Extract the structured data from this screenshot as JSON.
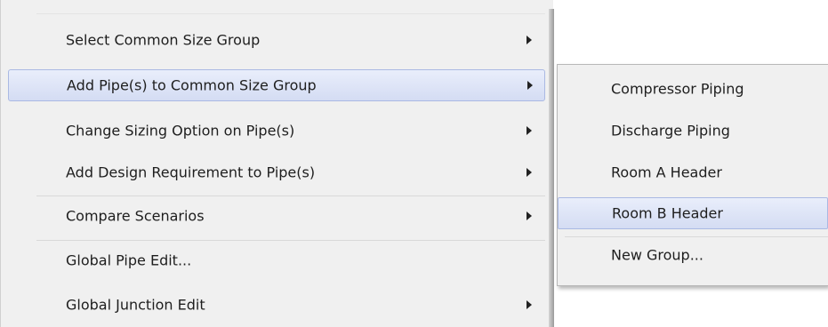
{
  "context_menu": {
    "items": [
      {
        "label": "Select Common Size Group",
        "has_submenu": true,
        "highlighted": false
      },
      {
        "label": "Add Pipe(s) to Common Size Group",
        "has_submenu": true,
        "highlighted": true
      },
      {
        "label": "Change Sizing Option on Pipe(s)",
        "has_submenu": true,
        "highlighted": false
      },
      {
        "label": "Add Design Requirement to Pipe(s)",
        "has_submenu": true,
        "highlighted": false
      },
      {
        "label": "Compare Scenarios",
        "has_submenu": true,
        "highlighted": false
      },
      {
        "label": "Global Pipe Edit...",
        "has_submenu": false,
        "highlighted": false
      },
      {
        "label": "Global Junction Edit",
        "has_submenu": true,
        "highlighted": false
      }
    ]
  },
  "submenu": {
    "items": [
      {
        "label": "Compressor Piping",
        "highlighted": false
      },
      {
        "label": "Discharge Piping",
        "highlighted": false
      },
      {
        "label": "Room A Header",
        "highlighted": false
      },
      {
        "label": "Room B Header",
        "highlighted": true
      },
      {
        "label": "New Group...",
        "highlighted": false
      }
    ]
  },
  "colors": {
    "menu_background": "#f0f0f0",
    "highlight_fill": "#d4dcf3",
    "highlight_border": "#aab9e3"
  }
}
